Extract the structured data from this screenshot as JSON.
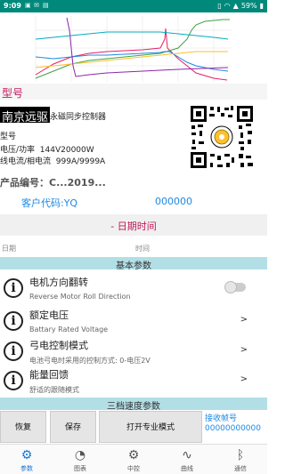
{
  "status": {
    "time": "9:09",
    "battery": "59%",
    "icons": [
      "app-notification-icon",
      "mail-icon",
      "image-icon",
      "vibrate-icon",
      "wifi-icon",
      "signal-icon",
      "battery-icon"
    ]
  },
  "chart": {
    "colors": [
      "#e91e63",
      "#43a047",
      "#1e88e5",
      "#fbc02d",
      "#8e24aa",
      "#00acc1"
    ]
  },
  "model_section": {
    "header": "型号",
    "brand_highlight": "南京远驱",
    "brand_rest": "永磁同步控制器",
    "model_label": "型号",
    "voltage_label": "电压/功率",
    "voltage_value": "144V20000W",
    "current_label": "线电流/相电流",
    "current_value": "999A/9999A",
    "product_no": "产品编号：C...2019...",
    "customer_code": "客户代码:YQ",
    "customer_value": "000000"
  },
  "date_section": {
    "header": "- 日期时间",
    "date_label": "日期",
    "time_label": "时间"
  },
  "basic": {
    "header": "基本参数",
    "rows": [
      {
        "title": "电机方向翻转",
        "sub": "Reverse Motor Roll Direction"
      },
      {
        "title": "额定电压",
        "sub": "Battary Rated Voltage",
        "arrow": ">"
      },
      {
        "title": "弓电控制模式",
        "sub": "电池弓电时采用的控制方式: 0-电压2V",
        "arrow": ">"
      },
      {
        "title": "能量回馈",
        "sub": "舒适的跟随模式",
        "arrow": ">"
      }
    ]
  },
  "speed": {
    "header": "三档速度参数"
  },
  "actions": {
    "restore": "恢复",
    "save": "保存",
    "pro_mode": "打开专业模式",
    "recv_label": "接收帧号",
    "recv_value": "00000000000"
  },
  "nav": [
    {
      "label": "参数",
      "icon": "gear-icon",
      "glyph": "⚙",
      "active": true
    },
    {
      "label": "图表",
      "icon": "gauge-icon",
      "glyph": "◔",
      "active": false
    },
    {
      "label": "中控",
      "icon": "gear-icon",
      "glyph": "⚙",
      "active": false
    },
    {
      "label": "曲线",
      "icon": "wave-icon",
      "glyph": "∿",
      "active": false
    },
    {
      "label": "通信",
      "icon": "bluetooth-icon",
      "glyph": "ᛒ",
      "active": false
    }
  ]
}
